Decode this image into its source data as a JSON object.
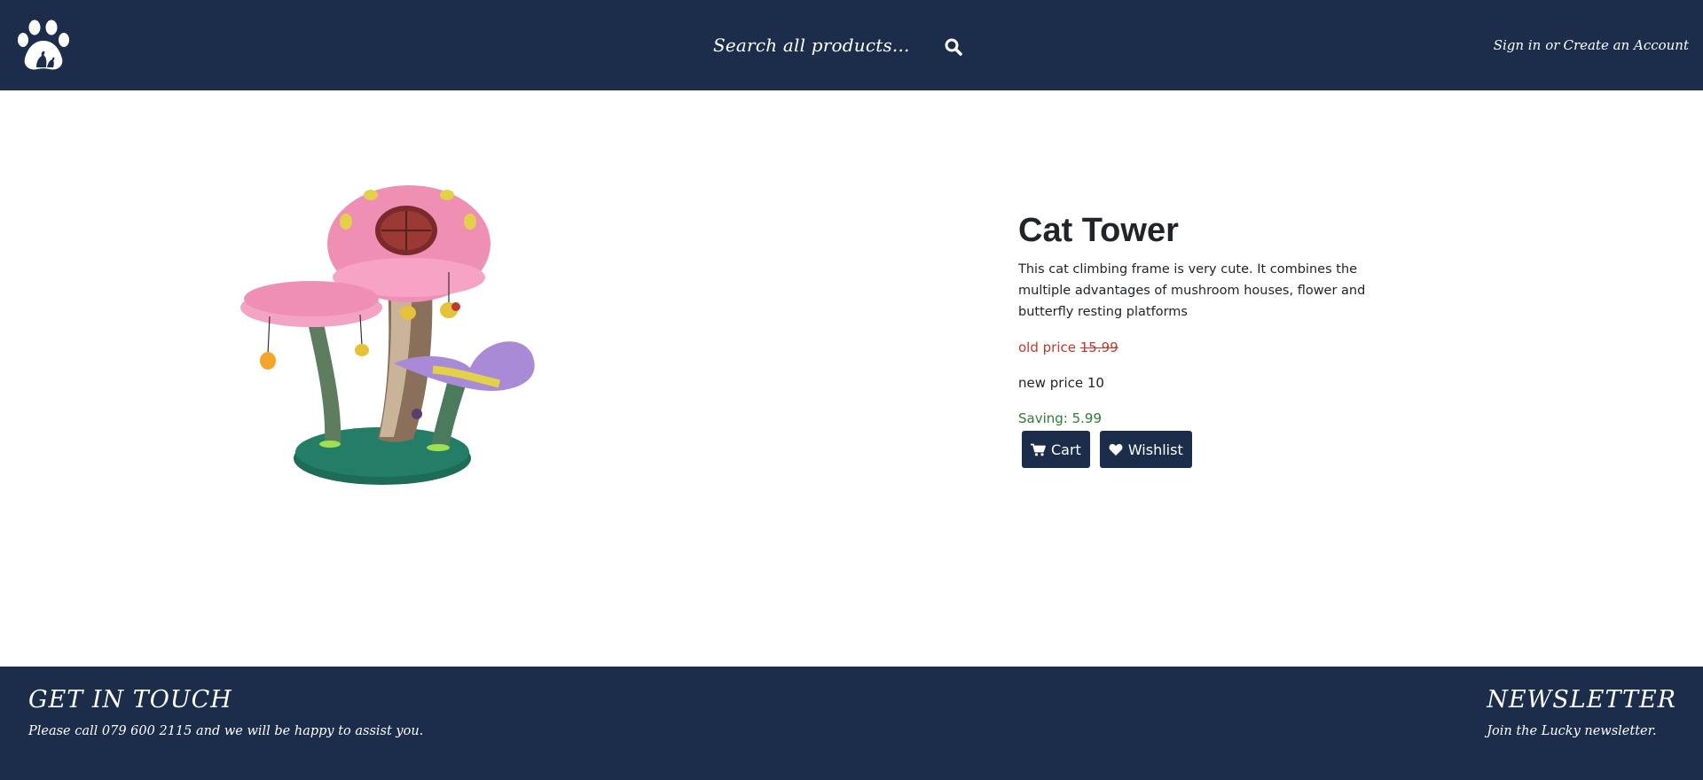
{
  "header": {
    "logo_icon": "paw-icon",
    "search": {
      "placeholder": "Search all products...",
      "icon": "search-icon"
    },
    "account": {
      "sign_in": "Sign in",
      "separator": "or",
      "create": "Create an Account"
    }
  },
  "product": {
    "image_icon": "cat-tower-image",
    "title": "Cat Tower",
    "description": "This cat climbing frame is very cute. It combines the multiple advantages of mushroom houses, flower and butterfly resting platforms",
    "old_price_label": "old price",
    "old_price_value": "15.99",
    "new_price_text": "new price 10",
    "saving_text": "Saving: 5.99",
    "buttons": {
      "cart": {
        "label": "Cart",
        "icon": "cart-icon"
      },
      "wishlist": {
        "label": "Wishlist",
        "icon": "heart-icon"
      }
    }
  },
  "footer": {
    "contact": {
      "heading": "GET IN TOUCH",
      "text": "Please call 079 600 2115 and we will be happy to assist you."
    },
    "newsletter": {
      "heading": "NEWSLETTER",
      "text": "Join the Lucky newsletter."
    }
  },
  "colors": {
    "brand_navy": "#1b2d4b",
    "old_price_red": "#c0392b",
    "saving_green": "#2e7d32"
  }
}
